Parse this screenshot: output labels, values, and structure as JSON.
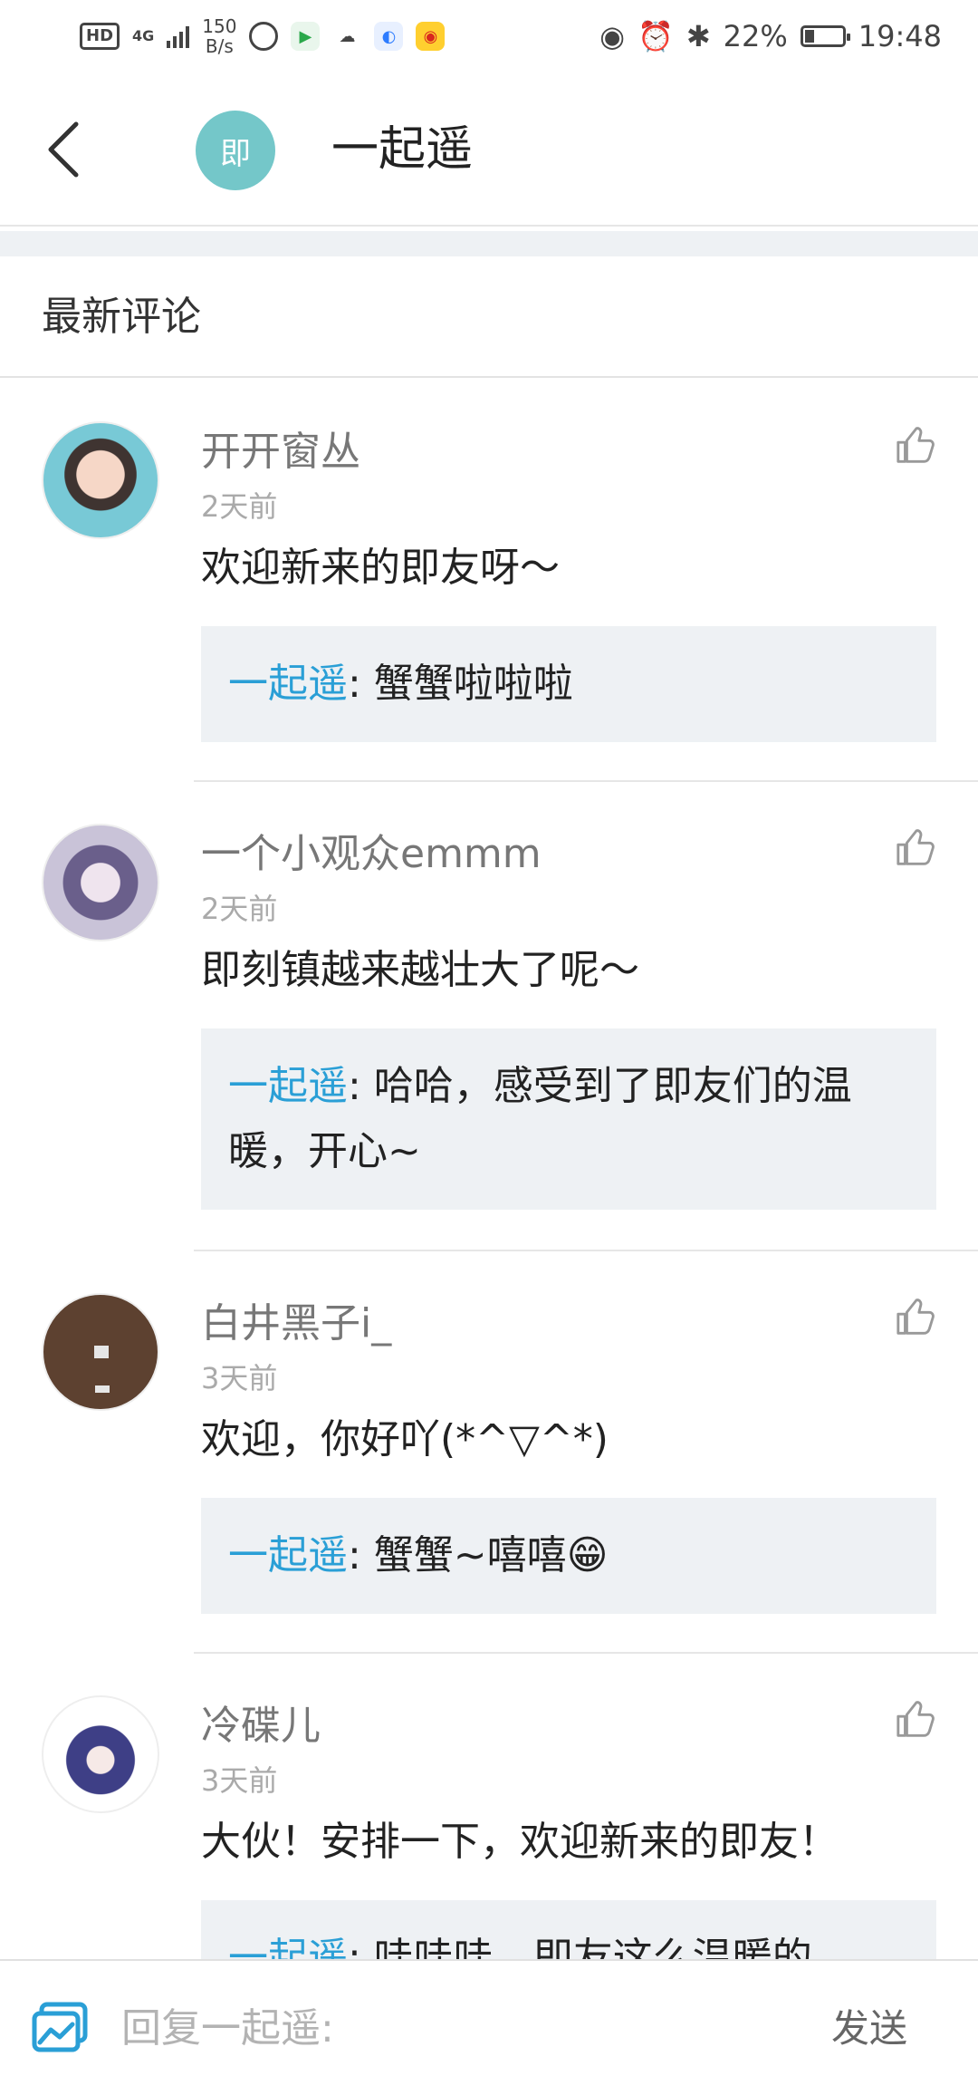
{
  "status_bar": {
    "hd": "HD",
    "network": "4G",
    "speed_value": "150",
    "speed_unit": "B/s",
    "battery": "22%",
    "time": "19:48"
  },
  "header": {
    "avatar_char": "即",
    "title": "一起遥"
  },
  "section": {
    "title": "最新评论"
  },
  "comments": [
    {
      "username": "开开窗丛",
      "time": "2天前",
      "text": "欢迎新来的即友呀～",
      "reply": {
        "name": "一起遥",
        "text": ": 蟹蟹啦啦啦"
      }
    },
    {
      "username": "一个小观众emmm",
      "time": "2天前",
      "text": "即刻镇越来越壮大了呢～",
      "reply": {
        "name": "一起遥",
        "text": ": 哈哈，感受到了即友们的温暖，开心~"
      }
    },
    {
      "username": "白井黑子i_",
      "time": "3天前",
      "text": "欢迎，你好吖(*^▽^*)",
      "reply": {
        "name": "一起遥",
        "text": ": 蟹蟹~嘻嘻😁"
      }
    },
    {
      "username": "冷碟儿",
      "time": "3天前",
      "text": "大伙！安排一下，欢迎新来的即友！",
      "reply": {
        "name": "一起遥",
        "text": ": 哇哇哇，即友这么温暖的"
      }
    }
  ],
  "bottom_bar": {
    "input_placeholder": "回复一起遥:",
    "send_label": "发送"
  }
}
